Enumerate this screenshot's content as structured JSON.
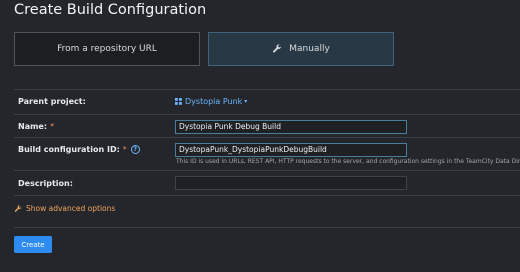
{
  "page": {
    "title": "Create Build Configuration"
  },
  "mode_tabs": {
    "repo_label": "From a repository URL",
    "manual_label": "Manually",
    "selected": "Manually"
  },
  "form": {
    "parent_project": {
      "label": "Parent project:",
      "value": "Dystopia Punk"
    },
    "name": {
      "label": "Name:",
      "required_marker": "*",
      "value": "Dystopia Punk Debug Build"
    },
    "build_config_id": {
      "label": "Build configuration ID:",
      "required_marker": "*",
      "help_glyph": "?",
      "value": "DystopaPunk_DystopiaPunkDebugBuild",
      "note": "This ID is used in URLs, REST API, HTTP requests to the server, and configuration settings in the TeamCity Data Direct"
    },
    "description": {
      "label": "Description:",
      "value": ""
    }
  },
  "advanced_link": "Show advanced options",
  "create_button": "Create",
  "colors": {
    "background": "#24262b",
    "link": "#6cb6ff",
    "advanced_link": "#f0a35e",
    "primary_button": "#2e8cf0",
    "selected_tab": "#283844",
    "required": "#f08b5d"
  },
  "icons": {
    "manual_tab": "wrench-icon",
    "parent_project": "grid-icon",
    "project_dropdown": "chevron-down-icon",
    "advanced_link": "wrench-icon",
    "id_help": "help-icon"
  }
}
